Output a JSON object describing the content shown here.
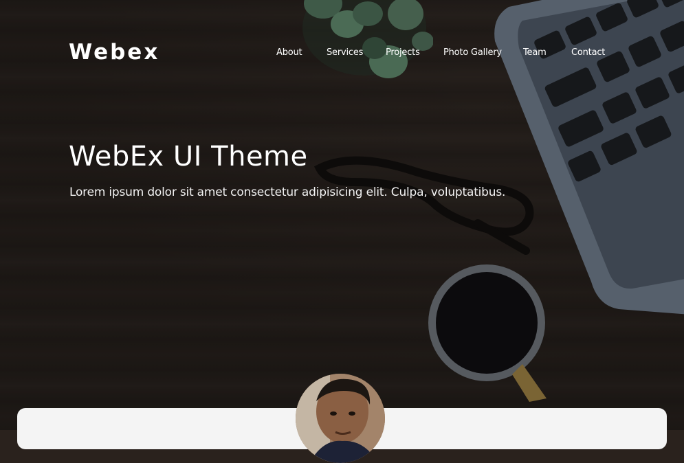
{
  "brand": {
    "name": "Webex"
  },
  "nav": {
    "items": [
      {
        "label": "About"
      },
      {
        "label": "Services"
      },
      {
        "label": "Projects"
      },
      {
        "label": "Photo Gallery"
      },
      {
        "label": "Team"
      },
      {
        "label": "Contact"
      }
    ]
  },
  "hero": {
    "title": "WebEx UI Theme",
    "subtitle": "Lorem ipsum dolor sit amet consectetur adipisicing elit. Culpa, voluptatibus.",
    "background_image": "desk-with-laptop-coffee-glasses-photo"
  },
  "profile": {
    "avatar": "profile-photo"
  },
  "colors": {
    "text": "#ffffff",
    "card": "#f4f4f4",
    "background": "#2c2520"
  }
}
